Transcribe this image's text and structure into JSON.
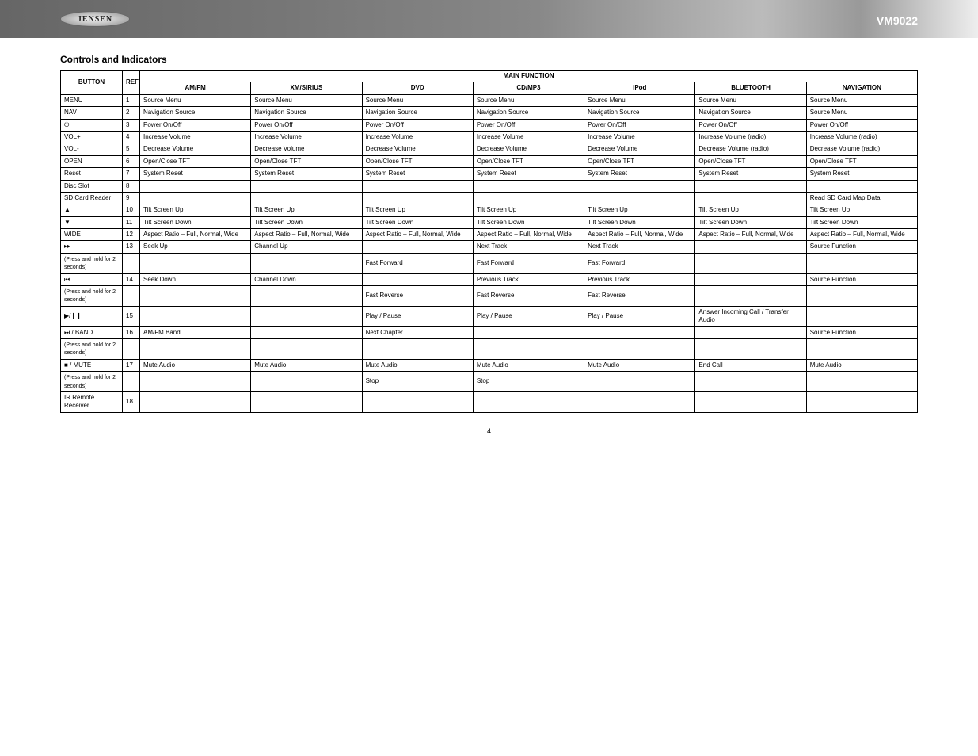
{
  "header": {
    "logo_text": "JENSEN",
    "model": "VM9022"
  },
  "title": "Controls and Indicators",
  "table_header": {
    "button": "BUTTON",
    "ref": "REF",
    "main_function": "MAIN FUNCTION",
    "sources": [
      "AM/FM",
      "XM/SIRIUS",
      "DVD",
      "CD/MP3",
      "iPod",
      "BLUETOOTH",
      "NAVIGATION"
    ]
  },
  "rows": [
    {
      "btn": "MENU",
      "ref": "1",
      "cells": [
        "Source Menu",
        "Source Menu",
        "Source Menu",
        "Source Menu",
        "Source Menu",
        "Source Menu",
        "Source Menu"
      ]
    },
    {
      "btn": "NAV",
      "ref": "2",
      "cells": [
        "Navigation Source",
        "Navigation Source",
        "Navigation Source",
        "Navigation Source",
        "Navigation Source",
        "Navigation Source",
        "Source Menu"
      ]
    },
    {
      "btn_icon": "⏻",
      "btn": "",
      "ref": "3",
      "cells": [
        "Power On/Off",
        "Power On/Off",
        "Power On/Off",
        "Power On/Off",
        "Power On/Off",
        "Power On/Off",
        "Power On/Off"
      ]
    },
    {
      "btn": "VOL+",
      "ref": "4",
      "cells": [
        "Increase Volume",
        "Increase Volume",
        "Increase Volume",
        "Increase Volume",
        "Increase Volume",
        "Increase Volume (radio)",
        "Increase Volume (radio)"
      ]
    },
    {
      "btn": "VOL-",
      "ref": "5",
      "cells": [
        "Decrease Volume",
        "Decrease Volume",
        "Decrease Volume",
        "Decrease Volume",
        "Decrease Volume",
        "Decrease Volume (radio)",
        "Decrease Volume (radio)"
      ]
    },
    {
      "btn": "OPEN",
      "ref": "6",
      "cells": [
        "Open/Close TFT",
        "Open/Close TFT",
        "Open/Close TFT",
        "Open/Close TFT",
        "Open/Close TFT",
        "Open/Close TFT",
        "Open/Close TFT"
      ]
    },
    {
      "btn": "Reset",
      "ref": "7",
      "cells": [
        "System Reset",
        "System Reset",
        "System Reset",
        "System Reset",
        "System Reset",
        "System Reset",
        "System Reset"
      ]
    },
    {
      "btn": "Disc Slot",
      "ref": "8",
      "cells": [
        "",
        "",
        "",
        "",
        "",
        "",
        ""
      ]
    },
    {
      "btn": "SD Card Reader",
      "ref": "9",
      "cells": [
        "",
        "",
        "",
        "",
        "",
        "",
        "Read SD Card Map Data"
      ]
    },
    {
      "btn_icon": "▲",
      "btn": "",
      "ref": "10",
      "cells": [
        "Tilt Screen Up",
        "Tilt Screen Up",
        "Tilt Screen Up",
        "Tilt Screen Up",
        "Tilt Screen Up",
        "Tilt Screen Up",
        "Tilt Screen Up"
      ]
    },
    {
      "btn_icon": "▼",
      "btn": "",
      "ref": "11",
      "cells": [
        "Tilt Screen Down",
        "Tilt Screen Down",
        "Tilt Screen Down",
        "Tilt Screen Down",
        "Tilt Screen Down",
        "Tilt Screen Down",
        "Tilt Screen Down"
      ]
    },
    {
      "btn": "WIDE",
      "ref": "12",
      "cells": [
        "Aspect Ratio – Full, Normal, Wide",
        "Aspect Ratio – Full, Normal, Wide",
        "Aspect Ratio – Full, Normal, Wide",
        "Aspect Ratio – Full, Normal, Wide",
        "Aspect Ratio – Full, Normal, Wide",
        "Aspect Ratio – Full, Normal, Wide",
        "Aspect Ratio – Full, Normal, Wide"
      ]
    },
    {
      "btn_icon": "▸▸",
      "btn": "",
      "ref": "13",
      "cells": [
        "Seek Up",
        "Channel Up",
        "",
        "Next Track",
        "Next Track",
        "",
        "Source Function"
      ]
    },
    {
      "btn": "",
      "sub": "(Press and hold for 2 seconds)",
      "ref": "",
      "cells": [
        "",
        "",
        "Fast Forward",
        "Fast Forward",
        "Fast Forward",
        "",
        ""
      ]
    },
    {
      "btn_icon": "⏮",
      "btn": "",
      "ref": "14",
      "cells": [
        "Seek Down",
        "Channel Down",
        "",
        "Previous Track",
        "Previous Track",
        "",
        "Source Function"
      ]
    },
    {
      "btn": "",
      "sub": "(Press and hold for 2 seconds)",
      "ref": "",
      "cells": [
        "",
        "",
        "Fast Reverse",
        "Fast Reverse",
        "Fast Reverse",
        "",
        ""
      ]
    },
    {
      "btn_icon": "▶/❙❙",
      "btn": "",
      "ref": "15",
      "cells": [
        "",
        "",
        "Play / Pause",
        "Play / Pause",
        "Play / Pause",
        "Answer Incoming Call / Transfer Audio",
        ""
      ]
    },
    {
      "btn_icon": "⏭",
      "btn": " / BAND",
      "ref": "16",
      "cells": [
        "AM/FM Band",
        "",
        "Next Chapter",
        "",
        "",
        "",
        "Source Function"
      ]
    },
    {
      "btn": "",
      "sub": "(Press and hold for 2 seconds)",
      "ref": "",
      "cells": [
        "",
        "",
        "",
        "",
        "",
        "",
        ""
      ]
    },
    {
      "btn_icon": "■ /",
      "btn": " MUTE",
      "ref": "17",
      "cells": [
        "Mute Audio",
        "Mute Audio",
        "Mute Audio",
        "Mute Audio",
        "Mute Audio",
        "End Call",
        "Mute Audio"
      ]
    },
    {
      "btn": "",
      "sub": "(Press and hold for 2 seconds)",
      "ref": "",
      "cells": [
        "",
        "",
        "Stop",
        "Stop",
        "",
        "",
        ""
      ]
    },
    {
      "btn": "IR Remote Receiver",
      "ref": "18",
      "cells": [
        "",
        "",
        "",
        "",
        "",
        "",
        ""
      ]
    }
  ],
  "page_number": "4"
}
